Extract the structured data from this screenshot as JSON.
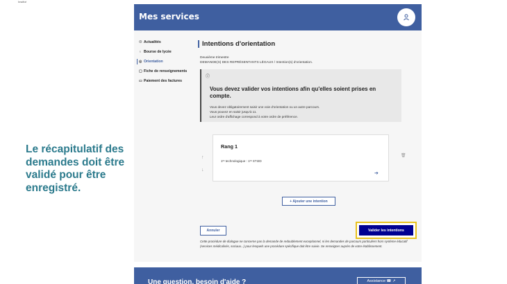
{
  "corner_mark": "Institut",
  "header": {
    "title": "Mes services",
    "avatar_icon": "user-icon"
  },
  "sidebar": {
    "items": [
      {
        "label": "Actualités",
        "icon": "☉"
      },
      {
        "label": "Bourse de lycée",
        "icon": "♁"
      },
      {
        "label": "Orientation",
        "icon": "◎"
      },
      {
        "label": "Fiche de renseignements",
        "icon": "▢"
      },
      {
        "label": "Paiement des factures",
        "icon": "▭"
      }
    ]
  },
  "main": {
    "title": "Intentions d'orientation",
    "term": "Deuxième trimestre",
    "breadcrumb": "DEMANDE(S) DES REPRÉSENTANTS LÉGAUX / Intention(s) d'orientation.",
    "info": {
      "title": "Vous devez valider vos intentions afin qu'elles soient prises en compte.",
      "lines": [
        "Vous devez obligatoirement saisir une voie d'orientation ou un autre parcours.",
        "Vous pouvez en saisir jusqu'à 11.",
        "Leur ordre d'affichage correspond à votre ordre de préférence."
      ]
    },
    "rank": {
      "title": "Rang 1",
      "subtitle": "1ʳᵉ technologique : 1ʳᵉ STI2D"
    },
    "add_button": "+ Ajouter une intention",
    "cancel_button": "Annuler",
    "validate_button": "Valider les intentions",
    "footnote": "Cette procédure de dialogue ne concerne pas la demande de redoublement exceptionnel, ni les demandes de parcours particuliers hors système éducatif (services médicalisés, sociaux...) pour lesquels une procédure spécifique doit être suivie. Se renseigner auprès de votre établissement."
  },
  "help": {
    "text": "Une question, besoin d'aide ?",
    "assist_button": "Assistance ☎ ↗"
  },
  "caption": "Le récapitulatif des demandes doit être validé pour être enregistré.",
  "colors": {
    "primary": "#3f5fa0",
    "validate": "#000091",
    "highlight": "#e8c11c",
    "caption": "#2b7a8c"
  }
}
